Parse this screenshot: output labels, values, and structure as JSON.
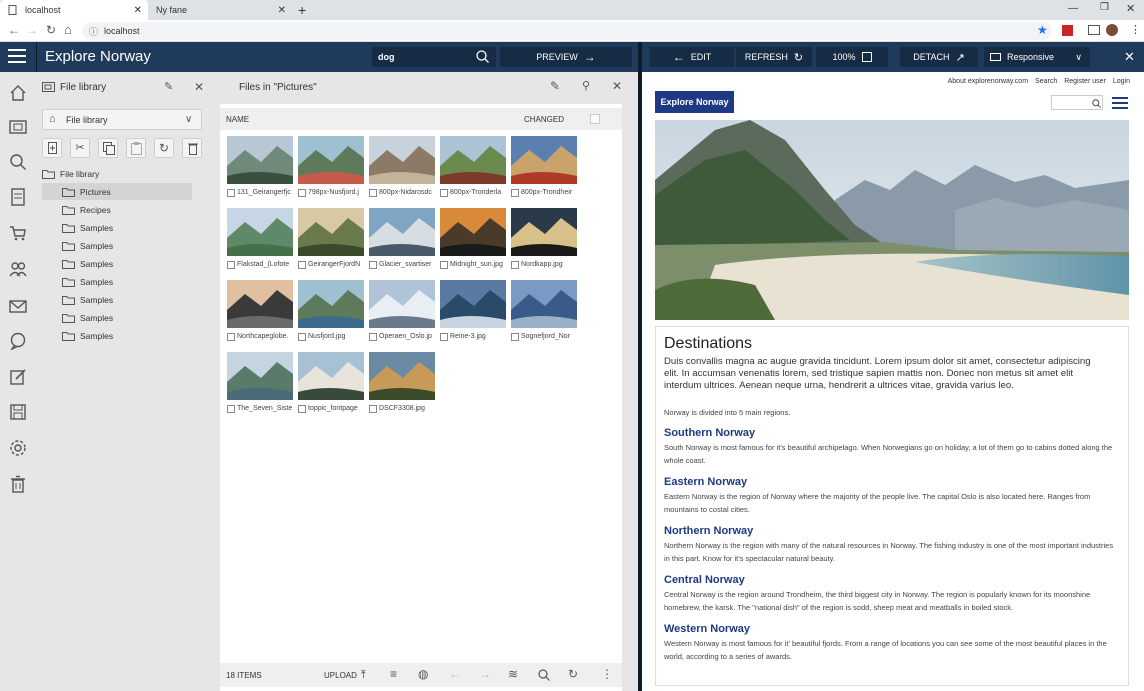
{
  "browser": {
    "tabs": [
      {
        "label": "localhost"
      },
      {
        "label": "Ny fane"
      }
    ],
    "url": "localhost",
    "window_controls": [
      "minimize",
      "maximize",
      "close"
    ]
  },
  "cms": {
    "title": "Explore Norway",
    "search_value": "dog",
    "preview_label": "PREVIEW"
  },
  "preview_toolbar": {
    "edit_label": "EDIT",
    "refresh_label": "REFRESH",
    "zoom_label": "100%",
    "detach_label": "DETACH",
    "device_label": "Responsive"
  },
  "library": {
    "title": "File library",
    "dropdown_label": "File library",
    "tree_root": "File library",
    "folders": [
      "Pictures",
      "Recipes",
      "Samples",
      "Samples",
      "Samples",
      "Samples",
      "Samples",
      "Samples",
      "Samples"
    ],
    "selected_folder": "Pictures"
  },
  "files": {
    "title": "Files in \"Pictures\"",
    "col_name": "NAME",
    "col_changed": "CHANGED",
    "items": [
      "131_Geirangerfjc",
      "798px-Nusfjord.j",
      "800px-Nidarosdc",
      "800px-Tronderla",
      "800px-Trondheir",
      "Flakstad_(Lofote",
      "GeirangerFjordN",
      "Glacier_svartiser",
      "Midnight_sun.jpg",
      "Nordkapp.jpg",
      "Northcapeglobe.",
      "Nusfjord.jpg",
      "Operaen_Oslo.jp",
      "Reine-3.jpg",
      "Sognefjord_Nor",
      "The_Seven_Siste",
      "toppic_fontpage",
      "DSCF3308.jpg"
    ],
    "count_label": "18 ITEMS",
    "upload_label": "UPLOAD"
  },
  "site": {
    "top_links": [
      "About explorenorway.com",
      "Search",
      "Register user",
      "Login"
    ],
    "logo": "Explore Norway",
    "heading": "Destinations",
    "intro": "Duis convallis magna ac augue gravida tincidunt. Lorem ipsum dolor sit amet, consectetur adipiscing elit. In accumsan venenatis lorem, sed tristique sapien mattis non. Donec non metus sit amet elit interdum ultrices. Aenean neque urna, hendrerit a ultrices vitae, gravida varius leo.",
    "lead": "Norway is divided into 5 main regions.",
    "regions": [
      {
        "title": "Southern Norway",
        "text": "South Norway is most famous for it's beautiful archipelago. When Norwegians go on holiday, a lot of them go to cabins dotted along the whole coast."
      },
      {
        "title": "Eastern Norway",
        "text": "Eastern Norway is the region of Norway where the majority of the people live. The capital Oslo is also located here. Ranges from mountains to costal cities."
      },
      {
        "title": "Northern Norway",
        "text": "Northern Norway is the region with many of the natural resources in Norway. The fishing industry is one of the most important industries in this part. Know for it's spectacular natural beauty."
      },
      {
        "title": "Central Norway",
        "text": "Central Norway is the region around Trondheim, the third biggest city in Norway. The region is popularly known for its moonshine homebrew, the karsk. The \"national dish\" of the region is sodd, sheep meat and meatballs in boiled stock."
      },
      {
        "title": "Western Norway",
        "text": "Western Norway is most famous for it' beautiful fjords. From a range of locations you can see some of the most beautiful places in the world, according to a series of awards."
      }
    ]
  },
  "colors": {
    "header": "#1f3a5a",
    "accent": "#1f3a84",
    "panel": "#e6e6e6"
  }
}
